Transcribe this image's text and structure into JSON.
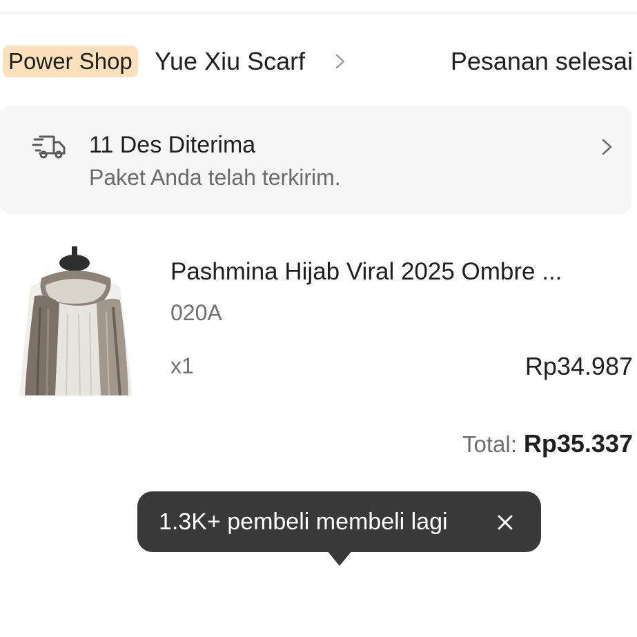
{
  "shop": {
    "badge": "Power Shop",
    "name": "Yue Xiu Scarf",
    "order_status": "Pesanan selesai",
    "chevron_icon": "chevron-right-icon"
  },
  "delivery": {
    "icon": "delivery-truck-icon",
    "title": "11 Des Diterima",
    "subtitle": "Paket Anda telah terkirim.",
    "chevron_icon": "chevron-right-icon"
  },
  "product": {
    "image": "pashmina-scarf-product-image",
    "name": "Pashmina Hijab Viral 2025 Ombre ...",
    "variant": "020A",
    "quantity": "x1",
    "price": "Rp34.987"
  },
  "total": {
    "label": "Total:",
    "value": "Rp35.337"
  },
  "tooltip": {
    "text": "1.3K+ pembeli membeli lagi",
    "close_icon": "close-icon"
  },
  "colors": {
    "badge_bg": "#fbe2bd",
    "card_bg": "#f6f6f6",
    "tooltip_bg": "#393939",
    "muted_text": "#6f6f6f"
  }
}
